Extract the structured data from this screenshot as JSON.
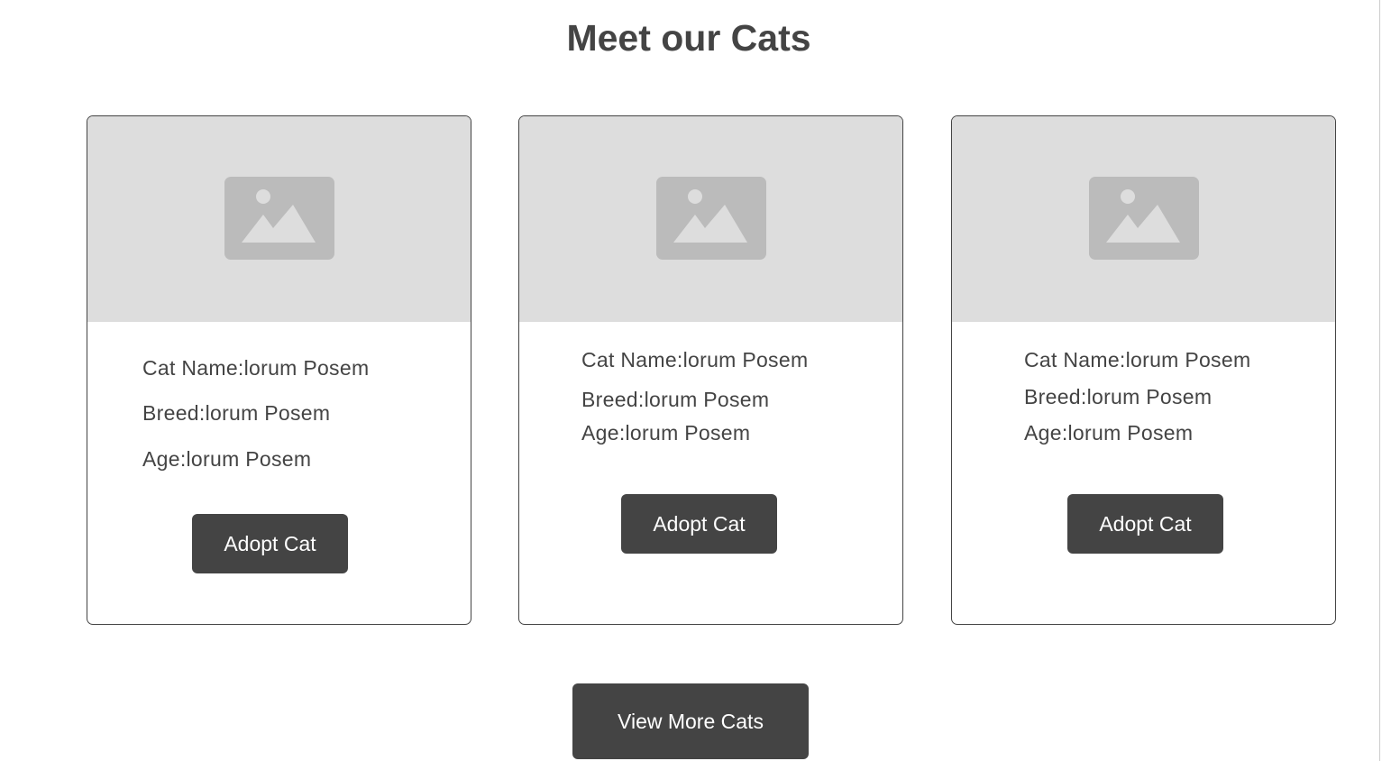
{
  "title": "Meet our Cats",
  "cards": [
    {
      "name": "Cat Name:lorum Posem",
      "breed": "Breed:lorum Posem",
      "age": "Age:lorum Posem",
      "button": "Adopt Cat"
    },
    {
      "name": "Cat Name:lorum Posem",
      "breed": "Breed:lorum Posem",
      "age": "Age:lorum Posem",
      "button": "Adopt Cat"
    },
    {
      "name": "Cat Name:lorum Posem",
      "breed": "Breed:lorum Posem",
      "age": "Age:lorum Posem",
      "button": "Adopt Cat"
    }
  ],
  "view_more": "View More Cats",
  "icons": {
    "placeholder": "image-placeholder-icon"
  },
  "colors": {
    "text": "#444444",
    "button_bg": "#444444",
    "button_text": "#ffffff",
    "image_bg": "#dddddd",
    "icon_bg": "#bbbbbb"
  }
}
